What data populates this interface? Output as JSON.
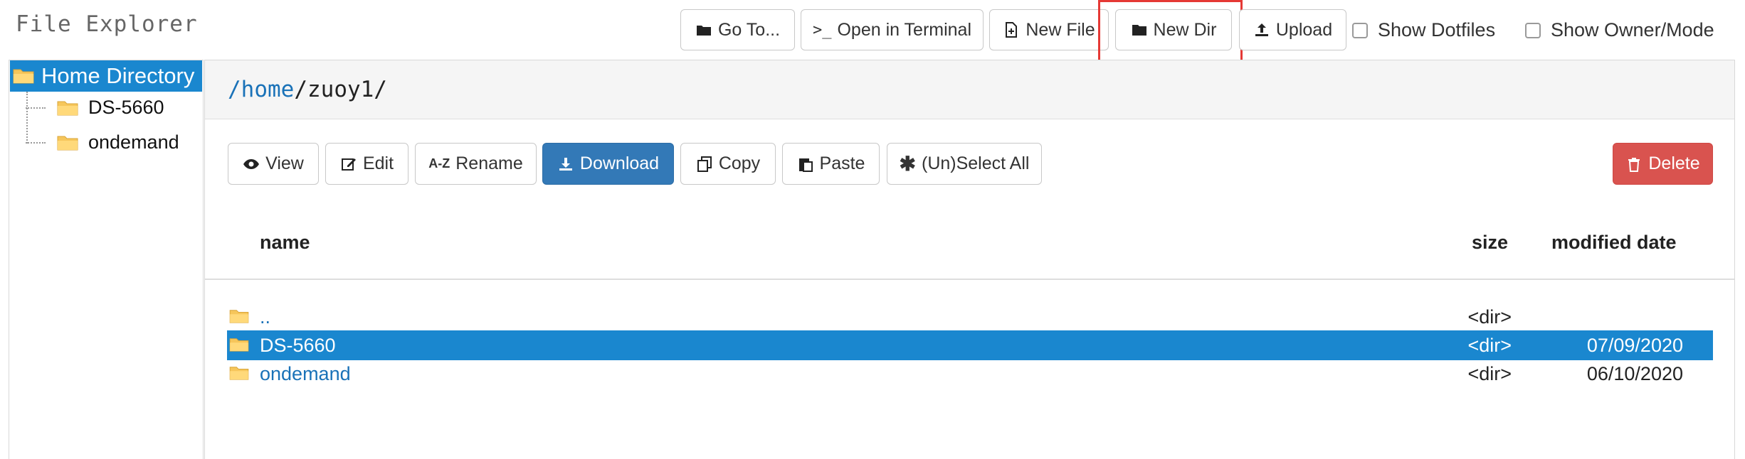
{
  "app": {
    "title": "File Explorer"
  },
  "toolbar": {
    "goto_label": "Go To...",
    "terminal_label": "Open in Terminal",
    "newfile_label": "New File",
    "newdir_label": "New Dir",
    "upload_label": "Upload",
    "show_dotfiles_label": "Show Dotfiles",
    "show_owner_label": "Show Owner/Mode"
  },
  "sidebar": {
    "root_label": "Home Directory",
    "items": [
      {
        "label": "DS-5660"
      },
      {
        "label": "ondemand"
      }
    ]
  },
  "path": {
    "root_link": "/home",
    "rest": "/zuoy1/"
  },
  "actions": {
    "view_label": "View",
    "edit_label": "Edit",
    "rename_label": "Rename",
    "download_label": "Download",
    "copy_label": "Copy",
    "paste_label": "Paste",
    "selectall_label": "(Un)Select All",
    "delete_label": "Delete"
  },
  "table": {
    "headers": {
      "name": "name",
      "size": "size",
      "modified": "modified date"
    },
    "rows": [
      {
        "name": "..",
        "size": "<dir>",
        "modified": "",
        "selected": false
      },
      {
        "name": "DS-5660",
        "size": "<dir>",
        "modified": "07/09/2020",
        "selected": true
      },
      {
        "name": "ondemand",
        "size": "<dir>",
        "modified": "06/10/2020",
        "selected": false
      }
    ]
  },
  "colors": {
    "accent": "#1a87cf",
    "primary_button": "#3379b7",
    "danger_button": "#d9534f",
    "highlight_box": "#e53935",
    "folder": "#f6c65b"
  },
  "icons": [
    "folder-icon",
    "terminal-icon",
    "new-file-icon",
    "upload-icon",
    "eye-icon",
    "edit-icon",
    "rename-icon",
    "download-icon",
    "copy-icon",
    "paste-icon",
    "asterisk-icon",
    "trash-icon"
  ]
}
